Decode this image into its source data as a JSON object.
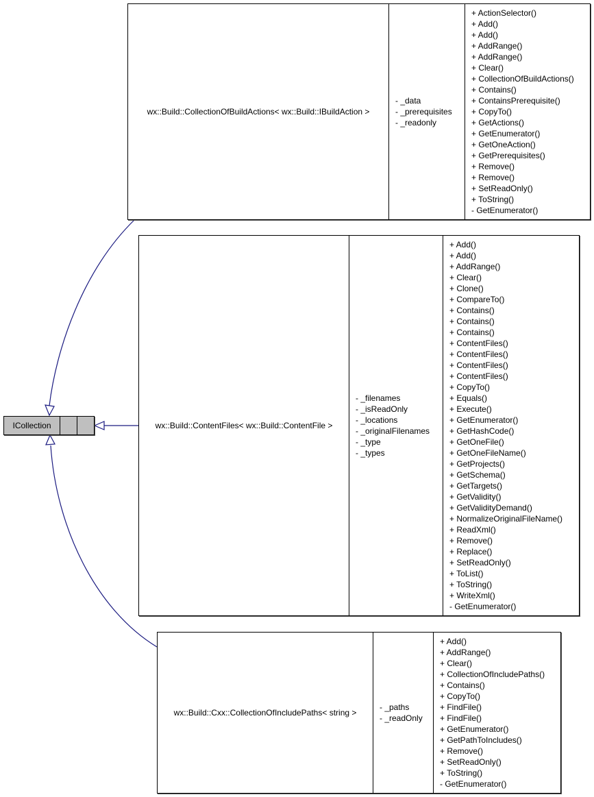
{
  "diagram": {
    "type": "uml-class-inheritance",
    "edge_color": "#1a1a80",
    "base_fill": "#bfbfbf",
    "base_class": {
      "name": "ICollection",
      "attributes": [],
      "methods": []
    },
    "derived_classes": [
      {
        "name": "wx::Build::CollectionOfBuildActions< wx::Build::IBuildAction >",
        "attributes": [
          "- _data",
          "- _prerequisites",
          "- _readonly"
        ],
        "methods": [
          "+ ActionSelector()",
          "+ Add()",
          "+ Add()",
          "+ AddRange()",
          "+ AddRange()",
          "+ Clear()",
          "+ CollectionOfBuildActions()",
          "+ Contains()",
          "+ ContainsPrerequisite()",
          "+ CopyTo()",
          "+ GetActions()",
          "+ GetEnumerator()",
          "+ GetOneAction()",
          "+ GetPrerequisites()",
          "+ Remove()",
          "+ Remove()",
          "+ SetReadOnly()",
          "+ ToString()",
          "- GetEnumerator()"
        ]
      },
      {
        "name": "wx::Build::ContentFiles< wx::Build::ContentFile >",
        "attributes": [
          "- _filenames",
          "- _isReadOnly",
          "- _locations",
          "- _originalFilenames",
          "- _type",
          "- _types"
        ],
        "methods": [
          "+ Add()",
          "+ Add()",
          "+ AddRange()",
          "+ Clear()",
          "+ Clone()",
          "+ CompareTo()",
          "+ Contains()",
          "+ Contains()",
          "+ Contains()",
          "+ ContentFiles()",
          "+ ContentFiles()",
          "+ ContentFiles()",
          "+ ContentFiles()",
          "+ CopyTo()",
          "+ Equals()",
          "+ Execute()",
          "+ GetEnumerator()",
          "+ GetHashCode()",
          "+ GetOneFile()",
          "+ GetOneFileName()",
          "+ GetProjects()",
          "+ GetSchema()",
          "+ GetTargets()",
          "+ GetValidity()",
          "+ GetValidityDemand()",
          "+ NormalizeOriginalFileName()",
          "+ ReadXml()",
          "+ Remove()",
          "+ Replace()",
          "+ SetReadOnly()",
          "+ ToList()",
          "+ ToString()",
          "+ WriteXml()",
          "- GetEnumerator()"
        ]
      },
      {
        "name": "wx::Build::Cxx::CollectionOfIncludePaths< string >",
        "attributes": [
          "- _paths",
          "- _readOnly"
        ],
        "methods": [
          "+ Add()",
          "+ AddRange()",
          "+ Clear()",
          "+ CollectionOfIncludePaths()",
          "+ Contains()",
          "+ CopyTo()",
          "+ FindFile()",
          "+ FindFile()",
          "+ GetEnumerator()",
          "+ GetPathToIncludes()",
          "+ Remove()",
          "+ SetReadOnly()",
          "+ ToString()",
          "- GetEnumerator()"
        ]
      }
    ]
  }
}
